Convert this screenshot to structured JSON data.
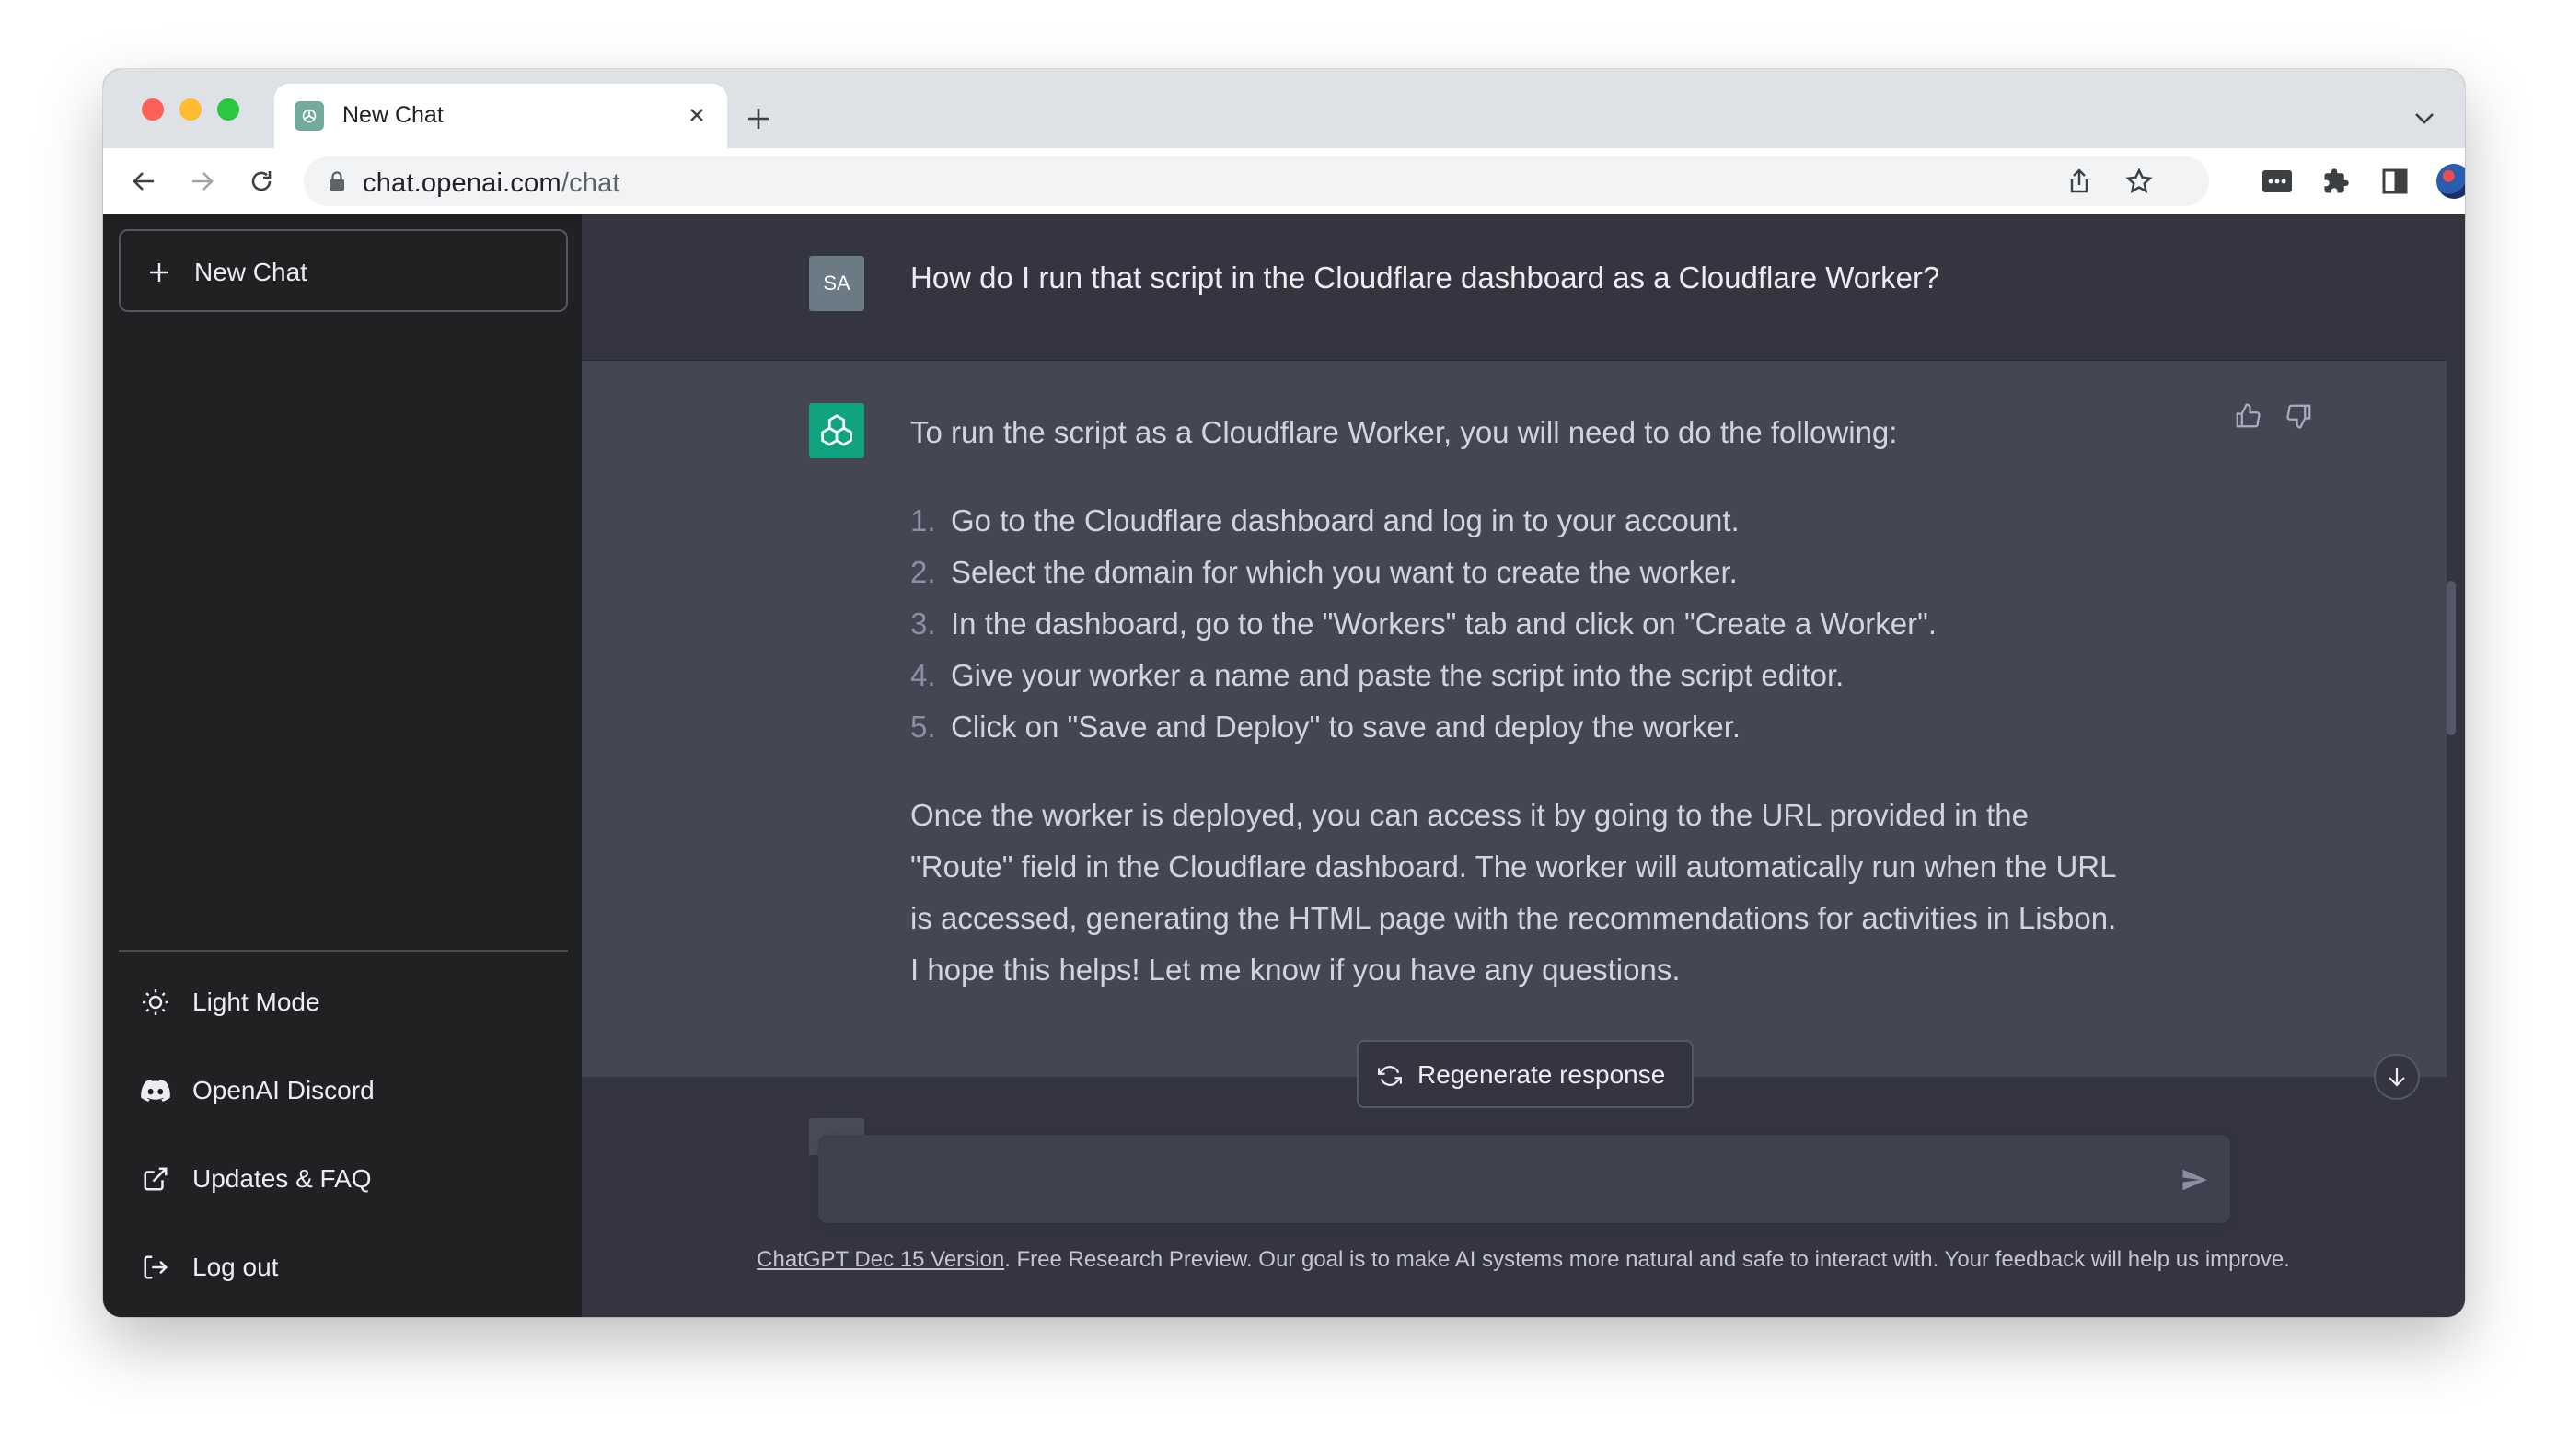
{
  "browser": {
    "tab_title": "New Chat",
    "url_host": "chat.openai.com",
    "url_path": "/chat"
  },
  "sidebar": {
    "new_chat_label": "New Chat",
    "items": [
      {
        "label": "Light Mode",
        "icon": "sun-icon"
      },
      {
        "label": "OpenAI Discord",
        "icon": "discord-icon"
      },
      {
        "label": "Updates & FAQ",
        "icon": "external-link-icon"
      },
      {
        "label": "Log out",
        "icon": "logout-icon"
      }
    ]
  },
  "conversation": {
    "user_initials": "SA",
    "user_message": "How do I run that script in the Cloudflare dashboard as a Cloudflare Worker?",
    "assistant": {
      "intro": "To run the script as a Cloudflare Worker, you will need to do the following:",
      "steps": [
        {
          "num": "1.",
          "text": "Go to the Cloudflare dashboard and log in to your account."
        },
        {
          "num": "2.",
          "text": "Select the domain for which you want to create the worker."
        },
        {
          "num": "3.",
          "text": "In the dashboard, go to the \"Workers\" tab and click on \"Create a Worker\"."
        },
        {
          "num": "4.",
          "text": "Give your worker a name and paste the script into the script editor."
        },
        {
          "num": "5.",
          "text": "Click on \"Save and Deploy\" to save and deploy the worker."
        }
      ],
      "para2": "Once the worker is deployed, you can access it by going to the URL provided in the \"Route\" field in the Cloudflare dashboard. The worker will automatically run when the URL is accessed, generating the HTML page with the recommendations for activities in Lisbon.",
      "para3": "I hope this helps! Let me know if you have any questions."
    }
  },
  "composer": {
    "regenerate_label": "Regenerate response",
    "input_value": ""
  },
  "footer": {
    "version_link": "ChatGPT Dec 15 Version",
    "text": ". Free Research Preview. Our goal is to make AI systems more natural and safe to interact with. Your feedback will help us improve."
  },
  "colors": {
    "sidebar_bg": "#202123",
    "main_bg": "#343541",
    "assistant_bg": "#444654",
    "brand_green": "#10a37f"
  }
}
